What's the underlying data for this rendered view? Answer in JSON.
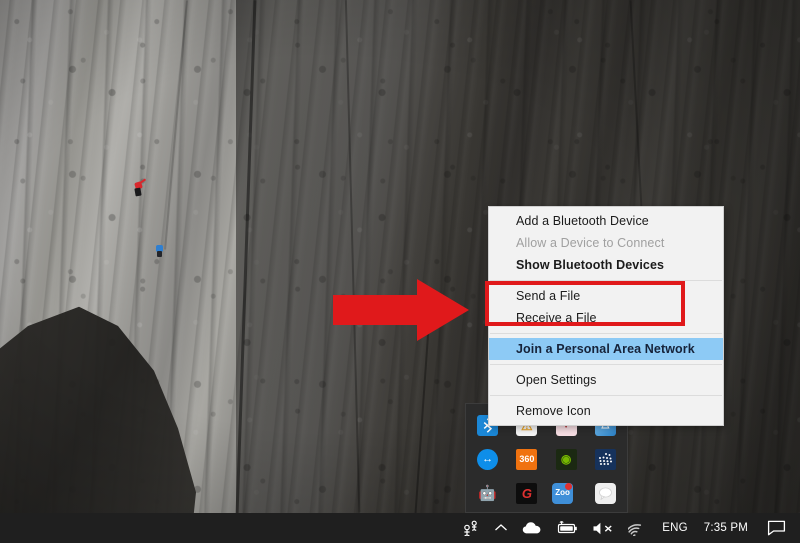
{
  "desktop": {
    "wallpaper_description": "rock climbers on a granite cliff face",
    "climber_red_label": "climber-red",
    "climber_blue_label": "climber-blue"
  },
  "annotation": {
    "arrow_icon": "right-arrow-icon",
    "arrow_color": "#e0191b",
    "highlight_box_color": "#e0191b"
  },
  "context_menu": {
    "title": "Bluetooth tray context menu",
    "background_color": "#f2f2f2",
    "highlight_color": "#8dcaf5",
    "groups": [
      {
        "items": [
          {
            "label": "Add a Bluetooth Device",
            "state": "normal"
          },
          {
            "label": "Allow a Device to Connect",
            "state": "disabled"
          },
          {
            "label": "Show Bluetooth Devices",
            "state": "bold"
          }
        ]
      },
      {
        "items": [
          {
            "label": "Send a File",
            "state": "normal"
          },
          {
            "label": "Receive a File",
            "state": "normal"
          }
        ]
      },
      {
        "items": [
          {
            "label": "Join a Personal Area Network",
            "state": "highlighted"
          }
        ]
      },
      {
        "items": [
          {
            "label": "Open Settings",
            "state": "normal"
          }
        ]
      },
      {
        "items": [
          {
            "label": "Remove Icon",
            "state": "normal"
          }
        ]
      }
    ]
  },
  "tray_overflow": {
    "background_color": "#2b2b2b",
    "rows": [
      [
        {
          "name": "bluetooth-tray-icon",
          "glyph": "ᛒ",
          "bg": "#1b87d6",
          "fg": "#ffffff"
        },
        {
          "name": "warning-tray-icon",
          "glyph": "⚠",
          "bg": "#f0f0f0",
          "fg": "#e8a020"
        },
        {
          "name": "mail-tray-icon",
          "glyph": "✉",
          "bg": "#f3d9de",
          "fg": "#c0392b"
        },
        {
          "name": "network-tray-icon",
          "glyph": "◥",
          "bg": "#4aa3e8",
          "fg": "#ffffff"
        }
      ],
      [
        {
          "name": "teamviewer-tray-icon",
          "glyph": "↔",
          "bg": "#0e8ee9",
          "fg": "#ffffff"
        },
        {
          "name": "360-security-tray-icon",
          "glyph": "360",
          "bg": "#f0720f",
          "fg": "#ffffff"
        },
        {
          "name": "nvidia-tray-icon",
          "glyph": "◉",
          "bg": "#1c2a12",
          "fg": "#76b900"
        },
        {
          "name": "intel-graphics-tray-icon",
          "glyph": "∷",
          "bg": "#16325c",
          "fg": "#ffffff"
        }
      ],
      [
        {
          "name": "android-tool-tray-icon",
          "glyph": "⬚",
          "bg": "#2b2b2b",
          "fg": "#3ddc84"
        },
        {
          "name": "gigabyte-tray-icon",
          "glyph": "G",
          "bg": "#0d0d0d",
          "fg": "#e03030"
        },
        {
          "name": "zoo-tray-icon",
          "glyph": "Zoo",
          "bg": "#2f7fd0",
          "fg": "#ffffff"
        },
        {
          "name": "chat-tray-icon",
          "glyph": "◯",
          "bg": "#efefef",
          "fg": "#cccccc"
        }
      ]
    ]
  },
  "taskbar": {
    "background_color": "#1f1f1f",
    "items": [
      {
        "name": "people-icon",
        "type": "icon",
        "label": "People"
      },
      {
        "name": "show-hidden-icons-chevron",
        "type": "icon",
        "label": "Show hidden icons"
      },
      {
        "name": "onedrive-icon",
        "type": "icon",
        "label": "OneDrive"
      },
      {
        "name": "battery-icon",
        "type": "icon",
        "label": "Battery"
      },
      {
        "name": "volume-muted-icon",
        "type": "icon",
        "label": "Volume muted"
      },
      {
        "name": "wifi-icon",
        "type": "icon",
        "label": "Network"
      },
      {
        "name": "language-indicator",
        "type": "text",
        "label": "ENG"
      },
      {
        "name": "clock",
        "type": "text",
        "label": "7:35 PM"
      },
      {
        "name": "action-center-icon",
        "type": "icon",
        "label": "Action Center"
      }
    ],
    "language": "ENG",
    "clock": "7:35 PM"
  }
}
